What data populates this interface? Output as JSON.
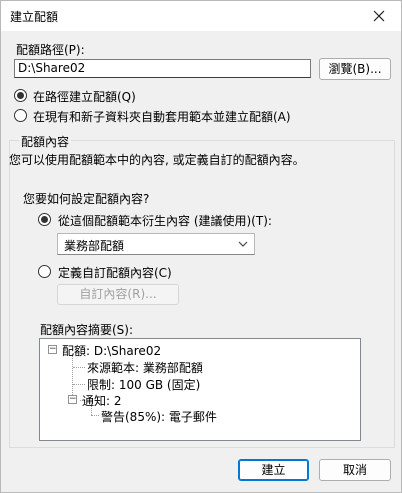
{
  "window": {
    "title": "建立配額"
  },
  "path": {
    "label": "配額路徑(P):",
    "value": "D:\\Share02",
    "browse_button": "瀏覽(B)..."
  },
  "scope": {
    "option_path": "在路徑建立配額(Q)",
    "option_auto": "在現有和新子資料夾自動套用範本並建立配額(A)"
  },
  "properties": {
    "group_label": "配額內容",
    "description": "您可以使用配額範本中的內容, 或定義自訂的配額內容。",
    "question": "您要如何設定配額內容?",
    "option_template": "從這個配額範本衍生內容 (建議使用)(T):",
    "template_selected": "業務部配額",
    "option_custom": "定義自訂配額內容(C)",
    "custom_button": "自訂內容(R)..."
  },
  "summary": {
    "label": "配額內容摘要(S):",
    "tree": [
      "配額: D:\\Share02",
      "來源範本: 業務部配額",
      "限制: 100 GB (固定)",
      "通知: 2",
      "警告(85%): 電子郵件"
    ]
  },
  "footer": {
    "create_button": "建立",
    "cancel_button": "取消"
  },
  "colors": {
    "accent": "#0078d4",
    "title_bg": "#ffffff",
    "dialog_bg": "#f0f0f0"
  }
}
